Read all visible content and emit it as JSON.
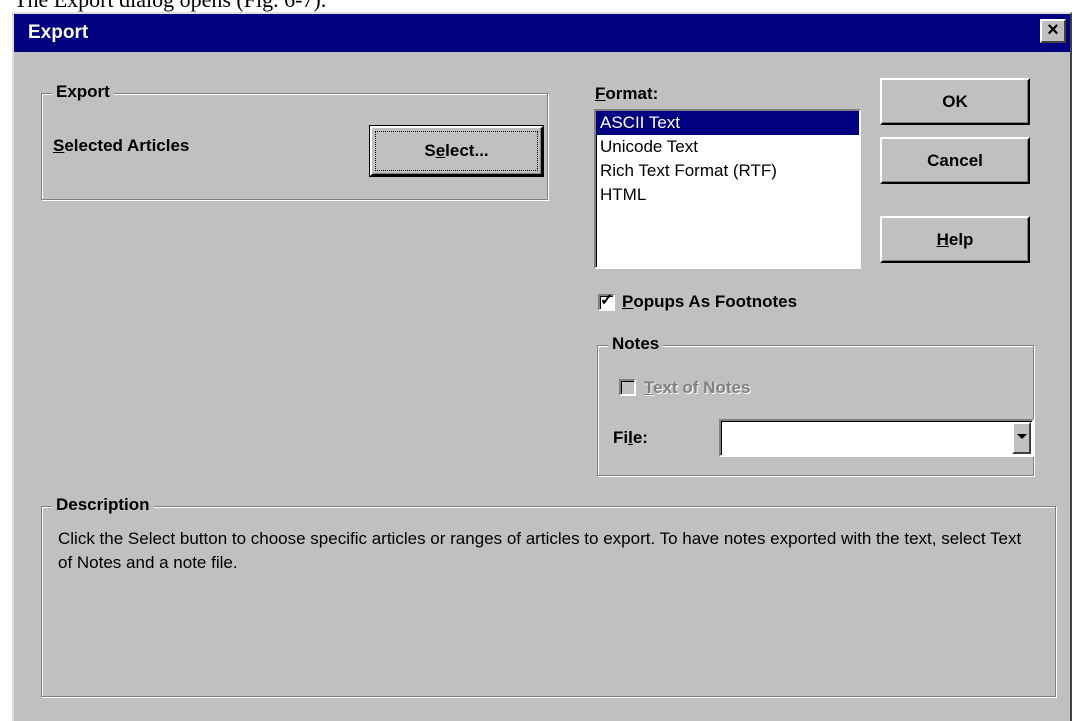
{
  "caption": "The Export dialog opens (Fig. 6-7).",
  "dialog": {
    "title": "Export",
    "close_icon": "close-icon"
  },
  "export_group": {
    "label": "Export",
    "selected_label": "Selected Articles",
    "select_button": "Select..."
  },
  "format": {
    "label": "Format:",
    "options": [
      "ASCII Text",
      "Unicode Text",
      "Rich Text Format (RTF)",
      "HTML"
    ],
    "selected": "ASCII Text"
  },
  "buttons": {
    "ok": "OK",
    "cancel": "Cancel",
    "help": "Help"
  },
  "popups_checkbox": {
    "label": "Popups As Footnotes",
    "checked": true
  },
  "notes_group": {
    "label": "Notes",
    "text_of_notes_label": "Text of Notes",
    "text_of_notes_checked": false,
    "text_of_notes_enabled": false,
    "file_label": "File:",
    "file_value": ""
  },
  "description": {
    "label": "Description",
    "text": "Click the Select button to choose specific articles or ranges of articles to export. To have notes exported with the text, select Text of Notes and a note file."
  }
}
